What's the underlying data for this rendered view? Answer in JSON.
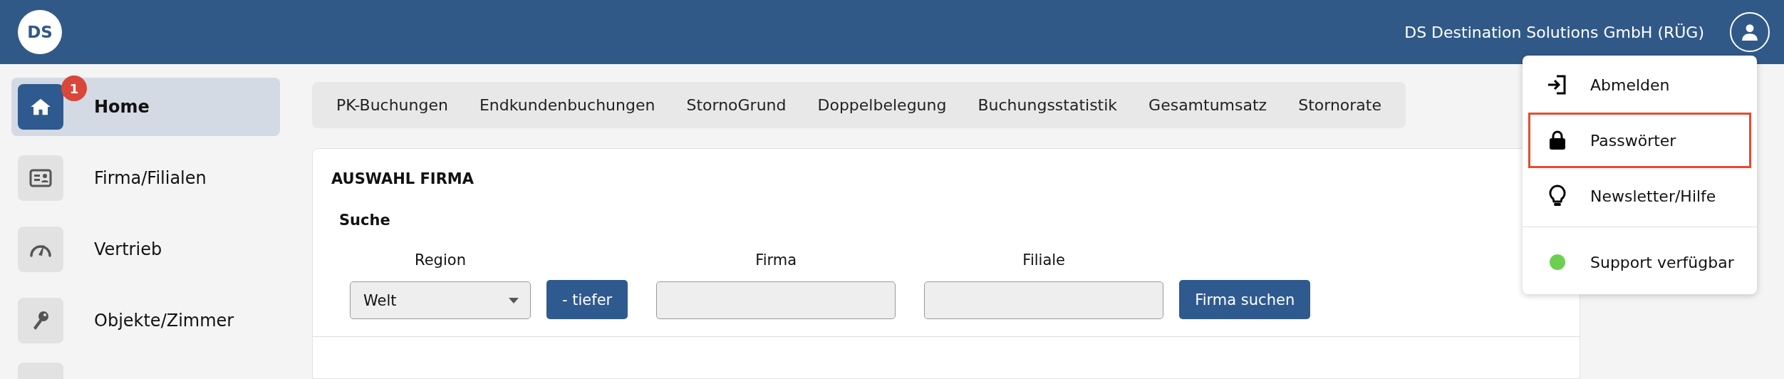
{
  "header": {
    "logo": "DS",
    "company": "DS Destination Solutions GmbH (RÜG)"
  },
  "sidebar": {
    "items": [
      {
        "label": "Home",
        "selected": true,
        "badge": "1"
      },
      {
        "label": "Firma/Filialen",
        "selected": false
      },
      {
        "label": "Vertrieb",
        "selected": false
      },
      {
        "label": "Objekte/Zimmer",
        "selected": false
      }
    ]
  },
  "tabs": [
    "PK-Buchungen",
    "Endkundenbuchungen",
    "StornoGrund",
    "Doppelbelegung",
    "Buchungsstatistik",
    "Gesamtumsatz",
    "Stornorate"
  ],
  "card": {
    "title": "AUSWAHL FIRMA",
    "section": "Suche",
    "fields": [
      {
        "kind": "select",
        "label": "Region",
        "value": "Welt"
      },
      {
        "kind": "button",
        "label": "- tiefer"
      },
      {
        "kind": "input",
        "label": "Firma"
      },
      {
        "kind": "input",
        "label": "Filiale"
      },
      {
        "kind": "button",
        "label": "Firma suchen"
      }
    ]
  },
  "user_menu": {
    "items": [
      {
        "kind": "action",
        "label": "Abmelden",
        "highlighted": false
      },
      {
        "kind": "action",
        "label": "Passwörter",
        "highlighted": true
      },
      {
        "kind": "action",
        "label": "Newsletter/Hilfe",
        "highlighted": false
      },
      {
        "kind": "status",
        "label": "Support verfügbar",
        "color": "#6ccf50",
        "highlighted": false
      }
    ]
  }
}
